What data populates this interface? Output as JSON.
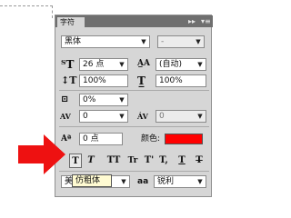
{
  "panel": {
    "tab_label": "字符",
    "collapse_label": "▸▸",
    "menu_label": "▾≡"
  },
  "font": {
    "family": "黑体",
    "style": "-"
  },
  "size": {
    "value": "26 点"
  },
  "leading": {
    "value": "(自动)"
  },
  "vertical_scale": {
    "value": "100%"
  },
  "horizontal_scale": {
    "value": "100%"
  },
  "tsume": {
    "value": "0%"
  },
  "kerning": {
    "value": "0"
  },
  "tracking": {
    "value": "0"
  },
  "baseline_shift": {
    "value": "0 点"
  },
  "color": {
    "label": "颜色:",
    "swatch": "#ff0000"
  },
  "text_styles": [
    "T",
    "T",
    "TT",
    "Tr",
    "T'",
    "T,",
    "T",
    "T"
  ],
  "active_style_tooltip": "仿粗体",
  "language": {
    "value": "美"
  },
  "antialias": {
    "icon_label": "aa",
    "value": "锐利"
  }
}
